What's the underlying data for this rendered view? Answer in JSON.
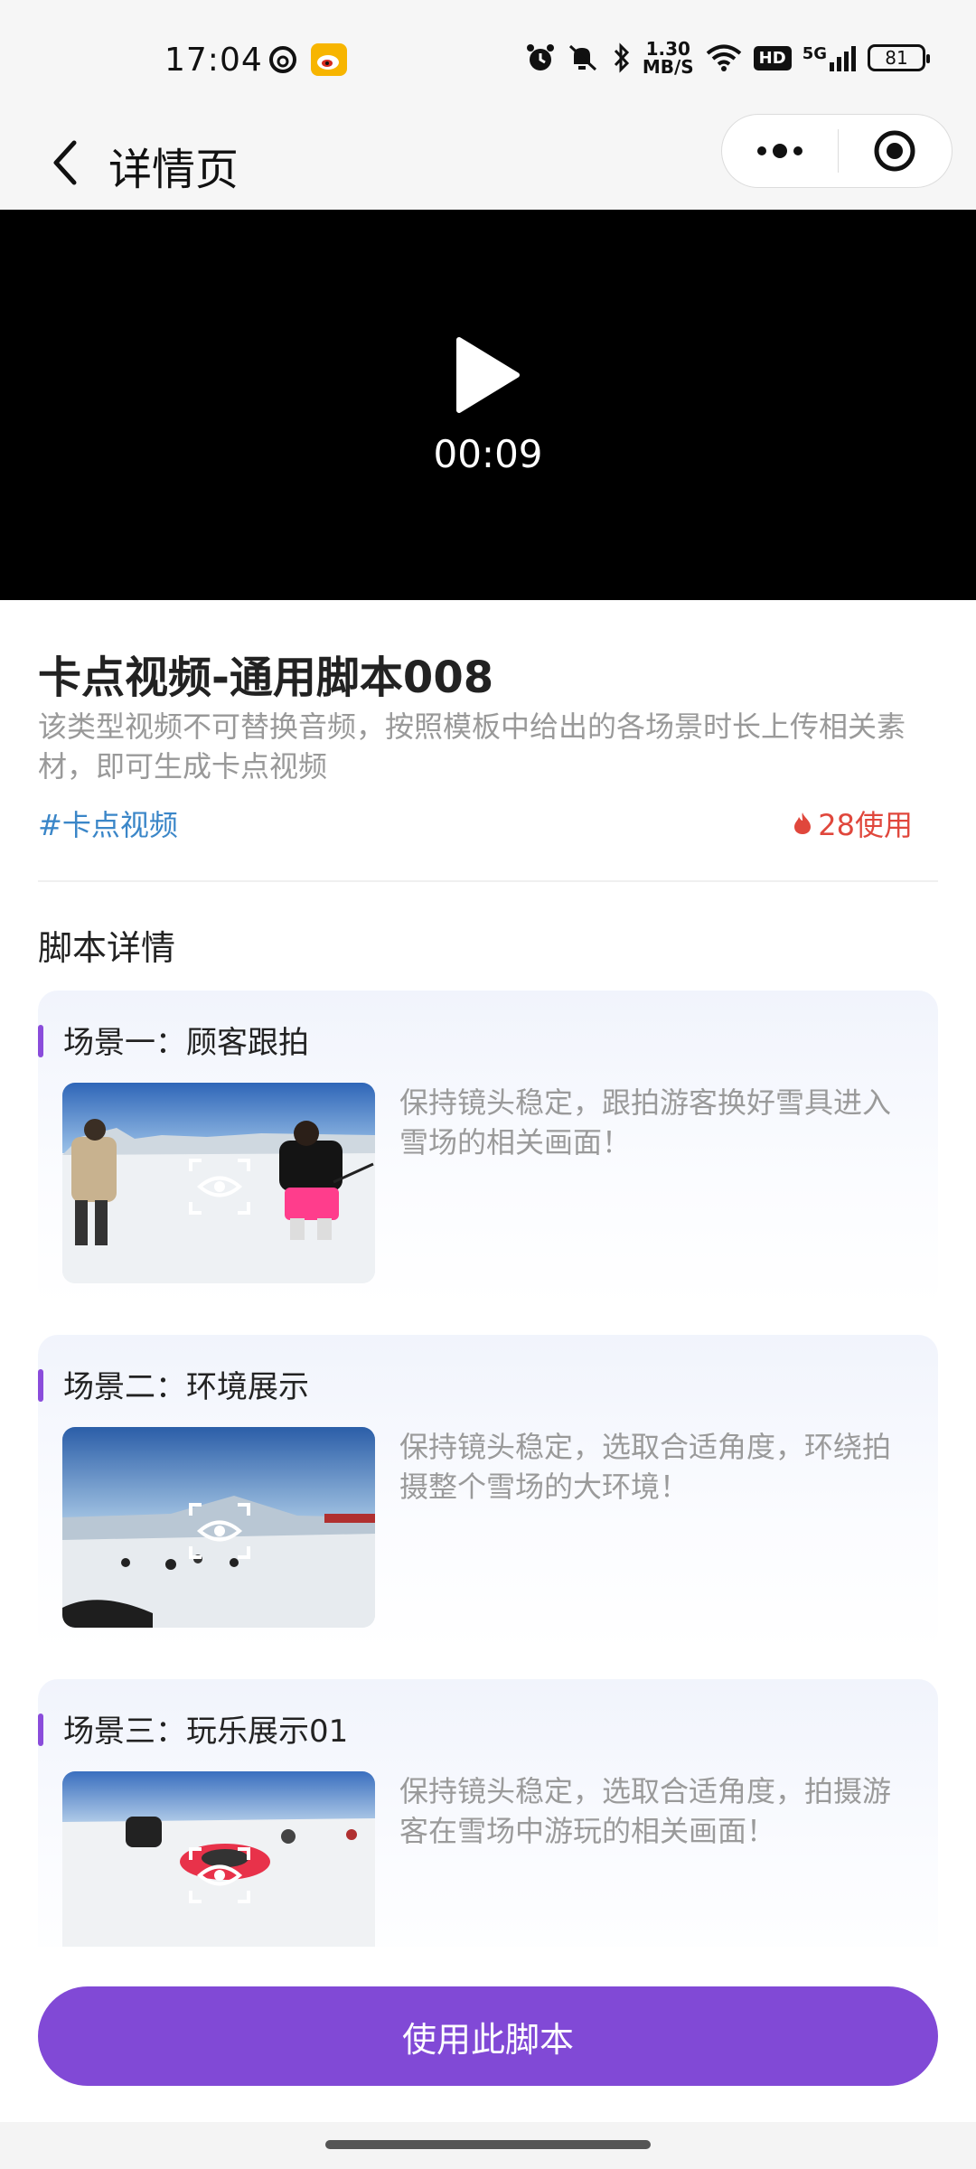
{
  "status_bar": {
    "time": "17:04",
    "net_speed_value": "1.30",
    "net_speed_unit": "MB/S",
    "hd_label": "HD",
    "signal_label": "5G",
    "battery": "81"
  },
  "nav": {
    "title": "详情页"
  },
  "video": {
    "duration": "00:09"
  },
  "template": {
    "title": "卡点视频-通用脚本008",
    "description": "该类型视频不可替换音频，按照模板中给出的各场景时长上传相关素材，即可生成卡点视频",
    "tag": "#卡点视频",
    "usage": "28使用"
  },
  "section_title": "脚本详情",
  "scenes": [
    {
      "title": "场景一：顾客跟拍",
      "description": "保持镜头稳定，跟拍游客换好雪具进入雪场的相关画面！"
    },
    {
      "title": "场景二：环境展示",
      "description": "保持镜头稳定，选取合适角度，环绕拍摄整个雪场的大环境！"
    },
    {
      "title": "场景三：玩乐展示01",
      "description": "保持镜头稳定，选取合适角度，拍摄游客在雪场中游玩的相关画面！"
    }
  ],
  "action": {
    "use_button": "使用此脚本"
  },
  "colors": {
    "accent": "#8149d6",
    "tag": "#3a86c8",
    "usage": "#e0473c"
  }
}
